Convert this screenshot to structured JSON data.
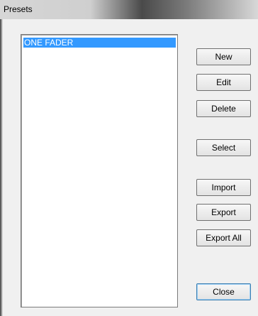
{
  "window": {
    "title": "Presets"
  },
  "list": {
    "items": [
      "ONE FADER"
    ]
  },
  "buttons": {
    "new": "New",
    "edit": "Edit",
    "delete": "Delete",
    "select": "Select",
    "import": "Import",
    "export": "Export",
    "export_all": "Export All",
    "close": "Close"
  },
  "colors": {
    "selection": "#3399ff",
    "background": "#f0f0f0"
  }
}
